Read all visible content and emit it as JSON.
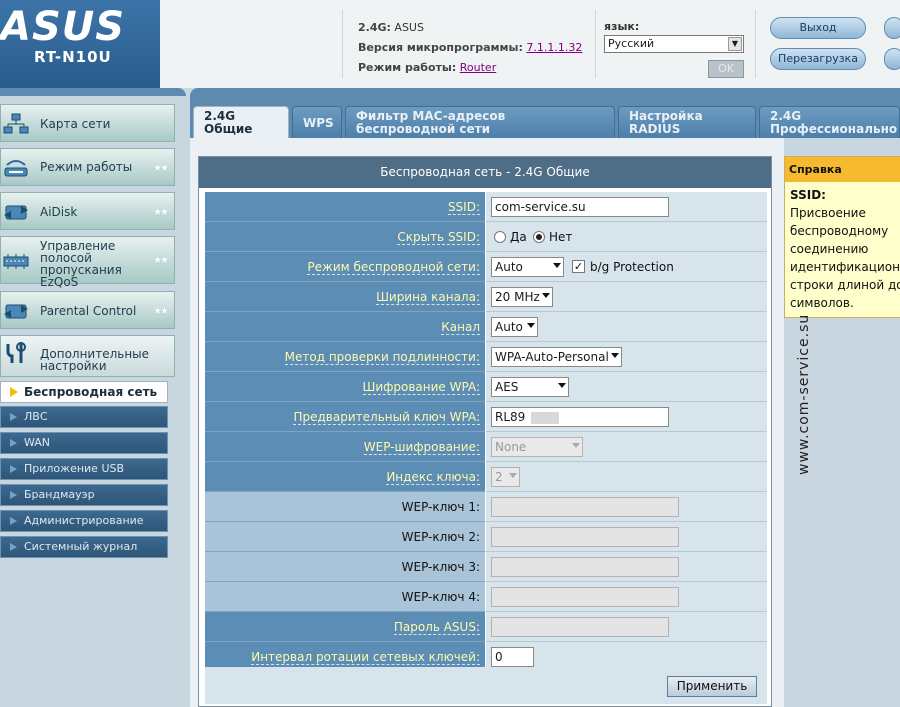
{
  "header": {
    "brand": "ASUS",
    "model": "RT-N10U",
    "ssid_label": "2.4G:",
    "ssid_value": "ASUS",
    "firmware_label": "Версия микропрограммы:",
    "firmware_value": "7.1.1.1.32",
    "mode_label": "Режим работы:",
    "mode_value": "Router",
    "language_label": "язык:",
    "language_value": "Русский",
    "ok_label": "OK",
    "logout_label": "Выход",
    "reboot_label": "Перезагрузка"
  },
  "sidebar": {
    "items": [
      {
        "label": "Карта сети",
        "icon": "network-map-icon"
      },
      {
        "label": "Режим работы",
        "icon": "router-icon"
      },
      {
        "label": "AiDisk",
        "icon": "aidisk-icon"
      },
      {
        "label": "Управление полосой пропускания EzQoS",
        "icon": "qos-icon"
      },
      {
        "label": "Parental Control",
        "icon": "parental-control-icon"
      },
      {
        "label": "Дополнительные настройки",
        "icon": "tools-icon"
      }
    ],
    "sub_items": [
      {
        "label": "Беспроводная сеть",
        "active": true
      },
      {
        "label": "ЛВС"
      },
      {
        "label": "WAN"
      },
      {
        "label": "Приложение USB"
      },
      {
        "label": "Брандмауэр"
      },
      {
        "label": "Администрирование"
      },
      {
        "label": "Системный журнал"
      }
    ]
  },
  "tabs": [
    {
      "label": "2.4G\nОбщие",
      "active": true
    },
    {
      "label": "WPS"
    },
    {
      "label": "Фильтр MAC-адресов беспроводной сети"
    },
    {
      "label": "Настройка RADIUS"
    },
    {
      "label": "2.4G Профессионально"
    }
  ],
  "panel": {
    "title": "Беспроводная сеть - 2.4G Общие",
    "ssid_label": "SSID:",
    "ssid_value": "com-service.su",
    "hide_ssid_label": "Скрыть SSID:",
    "hide_yes": "Да",
    "hide_no": "Нет",
    "mode_label": "Режим беспроводной сети:",
    "mode_value": "Auto",
    "protection_label": "b/g Protection",
    "bandwidth_label": "Ширина канала:",
    "bandwidth_value": "20 MHz",
    "channel_label": "Канал",
    "channel_value": "Auto",
    "auth_label": "Метод проверки подлинности:",
    "auth_value": "WPA-Auto-Personal",
    "wpa_enc_label": "Шифрование WPA:",
    "wpa_enc_value": "AES",
    "psk_label": "Предварительный ключ WPA:",
    "psk_value": "RL89",
    "wep_enc_label": "WEP-шифрование:",
    "wep_enc_value": "None",
    "key_index_label": "Индекс ключа:",
    "key_index_value": "2",
    "wep1_label": "WEP-ключ 1:",
    "wep2_label": "WEP-ключ 2:",
    "wep3_label": "WEP-ключ 3:",
    "wep4_label": "WEP-ключ 4:",
    "asus_pass_label": "Пароль ASUS:",
    "rotation_label": "Интервал ротации сетевых ключей:",
    "rotation_value": "0",
    "apply_label": "Применить"
  },
  "help": {
    "title": "Справка",
    "subtitle": "SSID:",
    "text": "Присвоение\nбеспроводному\nсоединению\nидентификацион\nстроки длиной до\nсимволов."
  },
  "watermark": "www.com-service.su"
}
